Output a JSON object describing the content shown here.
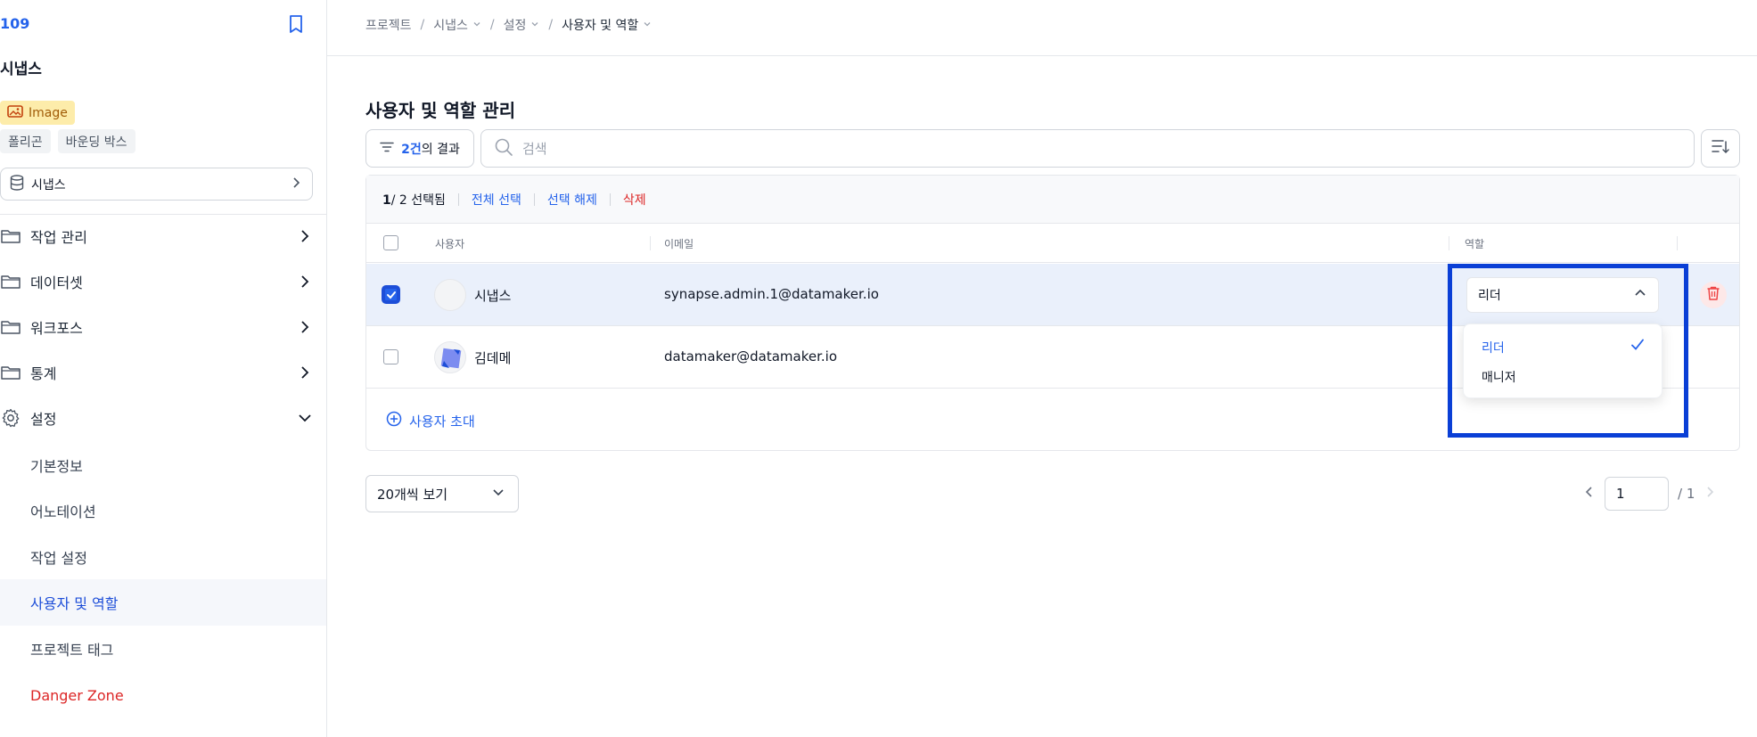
{
  "sidebar": {
    "project_id": "109",
    "project_name": "시냅스",
    "tags": {
      "image_label": "Image",
      "annotation_types": [
        "폴리곤",
        "바운딩 박스"
      ]
    },
    "dataset_select": "시냅스",
    "nav": [
      "작업 관리",
      "데이터셋",
      "워크포스",
      "통계",
      "설정"
    ],
    "settings_sub": [
      "기본정보",
      "어노테이션",
      "작업 설정",
      "사용자 및 역할",
      "프로젝트 태그",
      "Danger Zone"
    ]
  },
  "breadcrumb": [
    "프로젝트",
    "시냅스",
    "설정",
    "사용자 및 역할"
  ],
  "page": {
    "title": "사용자 및 역할 관리",
    "filter_count": "2건",
    "filter_suffix": "의 결과",
    "search_placeholder": "검색"
  },
  "selection": {
    "selected": "1",
    "total": "/ 2",
    "selected_suffix": " 선택됨",
    "select_all": "전체 선택",
    "deselect": "선택 해제",
    "delete": "삭제"
  },
  "table": {
    "columns": [
      "사용자",
      "이메일",
      "역할"
    ],
    "rows": [
      {
        "name": "시냅스",
        "email": "synapse.admin.1@datamaker.io",
        "role": "리더",
        "checked": true
      },
      {
        "name": "김데메",
        "email": "datamaker@datamaker.io",
        "role": "",
        "checked": false
      }
    ]
  },
  "role_dropdown": {
    "options": [
      "리더",
      "매니저"
    ],
    "selected": "리더"
  },
  "invite_label": "사용자 초대",
  "pagination": {
    "page_size": "20개씩 보기",
    "current": "1",
    "total": "/ 1"
  },
  "colors": {
    "accent": "#2563eb",
    "danger": "#dc2626",
    "highlight": "#0a3fd6",
    "tag_image_bg": "#fdecaa"
  }
}
